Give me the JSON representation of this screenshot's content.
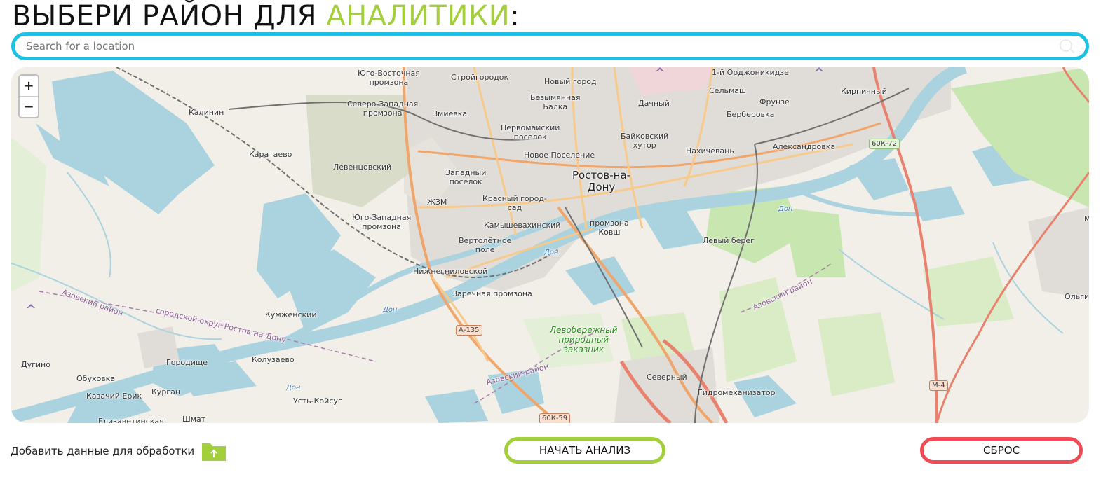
{
  "header": {
    "title_part1": "ВЫБЕРИ РАЙОН ДЛЯ ",
    "title_accent": "АНАЛИТИКИ",
    "title_suffix": ":"
  },
  "search": {
    "placeholder": "Search for a location",
    "value": "",
    "icon": "search-icon"
  },
  "map": {
    "zoom_in_label": "+",
    "zoom_out_label": "−",
    "labels": {
      "rostov": "Ростов-на-\nДону",
      "yugo_vost": "Юго-Восточная\nпромзона",
      "stroigorodok": "Стройгородок",
      "noviy_gorod": "Новый город",
      "ordzhonikidze": "1-й Орджоникидзе",
      "kirpichniy": "Кирпичный",
      "kalinin": "Калинин",
      "severo_zap": "Северо-Западная\nпромзона",
      "zmievka": "Змиевка",
      "bezymyannaya": "Безымянная\nБалка",
      "dachniy": "Дачный",
      "selmash": "Сельмаш",
      "frunze": "Фрунзе",
      "berberovka": "Берберовка",
      "pervomaiskiy": "Первомайский\nпоселок",
      "baikovskiy": "Байковский\nхутор",
      "nakhichevan": "Нахичевань",
      "aleksandrovka": "Александровка",
      "karataevo": "Каратаево",
      "novoe_poselenie": "Новое Поселение",
      "leventsovskiy": "Левенцовский",
      "zapadniy": "Западный\nпоселок",
      "zhzm": "ЖЗМ",
      "krasniy_gorod": "Красный город-\nсад",
      "yugo_zap": "Юго-Западная\nпромзона",
      "kamyshevakhinskiy": "Камышевахинский",
      "promzona_kovsh": "промзона\nКовш",
      "leviy_bereg": "Левый берег",
      "vertoletnoe": "Вертолётное\nполе",
      "nizhnegnilovskoy": "Нижнегниловской",
      "zarechnaya": "Заречная промзона",
      "kumzhenskiy": "Кумженский",
      "ol_gin": "Ольгин",
      "gorodische": "Городище",
      "kolusaevo": "Колузаево",
      "dugino": "Дугино",
      "obukhovka": "Обуховка",
      "kazachiy": "Казачий Ерик",
      "kurgan": "Курган",
      "ust_koisug": "Усть-Койсуг",
      "elizavetinskaya": "Елизаветинская",
      "shmat": "Шмат",
      "severniy": "Северный",
      "gidromekh": "Гидромеханизатор",
      "m_edge": "М",
      "park": "Левобережный\nприродный\nзаказник",
      "azov_rayon_1": "Азовский район",
      "azov_rayon_2": "Азовский район",
      "azov_rayon_3": "Азовский район",
      "gorodskoy_okrug": "городской округ Ростов-на-Дону",
      "don_1": "Дон",
      "don_2": "Дон",
      "don_3": "Дон",
      "don_4": "Дон"
    },
    "shields": {
      "r60k72": "60К-72",
      "a135": "А-135",
      "r60k59": "60К-59",
      "m4": "М-4"
    },
    "colors": {
      "land": "#f2efe9",
      "water": "#aad3df",
      "urban": "#dddddd",
      "green": "#c8e6b0",
      "major_road": "#f0a56b",
      "secondary_road": "#f7f3a8",
      "motorway": "#e8826e"
    }
  },
  "footer": {
    "upload_label": "Добавить данные для обработки",
    "upload_icon": "folder-upload-icon",
    "start_label": "НАЧАТЬ АНАЛИЗ",
    "reset_label": "СБРОС",
    "accent_green": "#a3cf3a",
    "accent_red": "#f04a55",
    "accent_cyan": "#1fc1e3"
  }
}
